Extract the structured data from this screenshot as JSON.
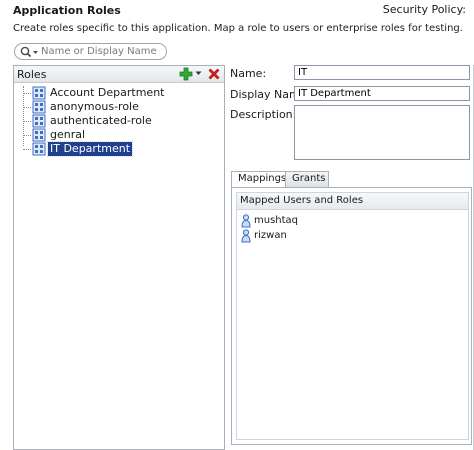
{
  "header": {
    "title": "Application Roles",
    "security_policy_label": "Security Policy:",
    "description": "Create roles specific to this application. Map a role to users or enterprise roles for testing."
  },
  "search": {
    "placeholder": "Name or Display Name",
    "value": ""
  },
  "roles": {
    "heading": "Roles",
    "items": [
      {
        "label": "Account Department",
        "selected": false
      },
      {
        "label": "anonymous-role",
        "selected": false
      },
      {
        "label": "authenticated-role",
        "selected": false
      },
      {
        "label": "genral",
        "selected": false
      },
      {
        "label": "IT Department",
        "selected": true
      }
    ]
  },
  "details": {
    "name_label": "Name:",
    "name_value": "IT",
    "display_name_label": "Display Name:",
    "display_name_value": "IT Department",
    "description_label": "Description:",
    "description_value": ""
  },
  "tabs": [
    {
      "label": "Mappings",
      "active": true
    },
    {
      "label": "Grants",
      "active": false
    }
  ],
  "mappings": {
    "heading": "Mapped Users and Roles",
    "users": [
      "mushtaq",
      "rizwan"
    ]
  },
  "colors": {
    "selection": "#1f3f8f",
    "add_icon": "#2fa83a",
    "delete_icon": "#d42020",
    "role_icon": "#3f6fc4"
  },
  "icons": {
    "search": "magnifier-dropdown-icon",
    "add": "green-plus-icon",
    "delete": "red-x-icon",
    "role": "role-group-icon",
    "user": "user-icon"
  }
}
